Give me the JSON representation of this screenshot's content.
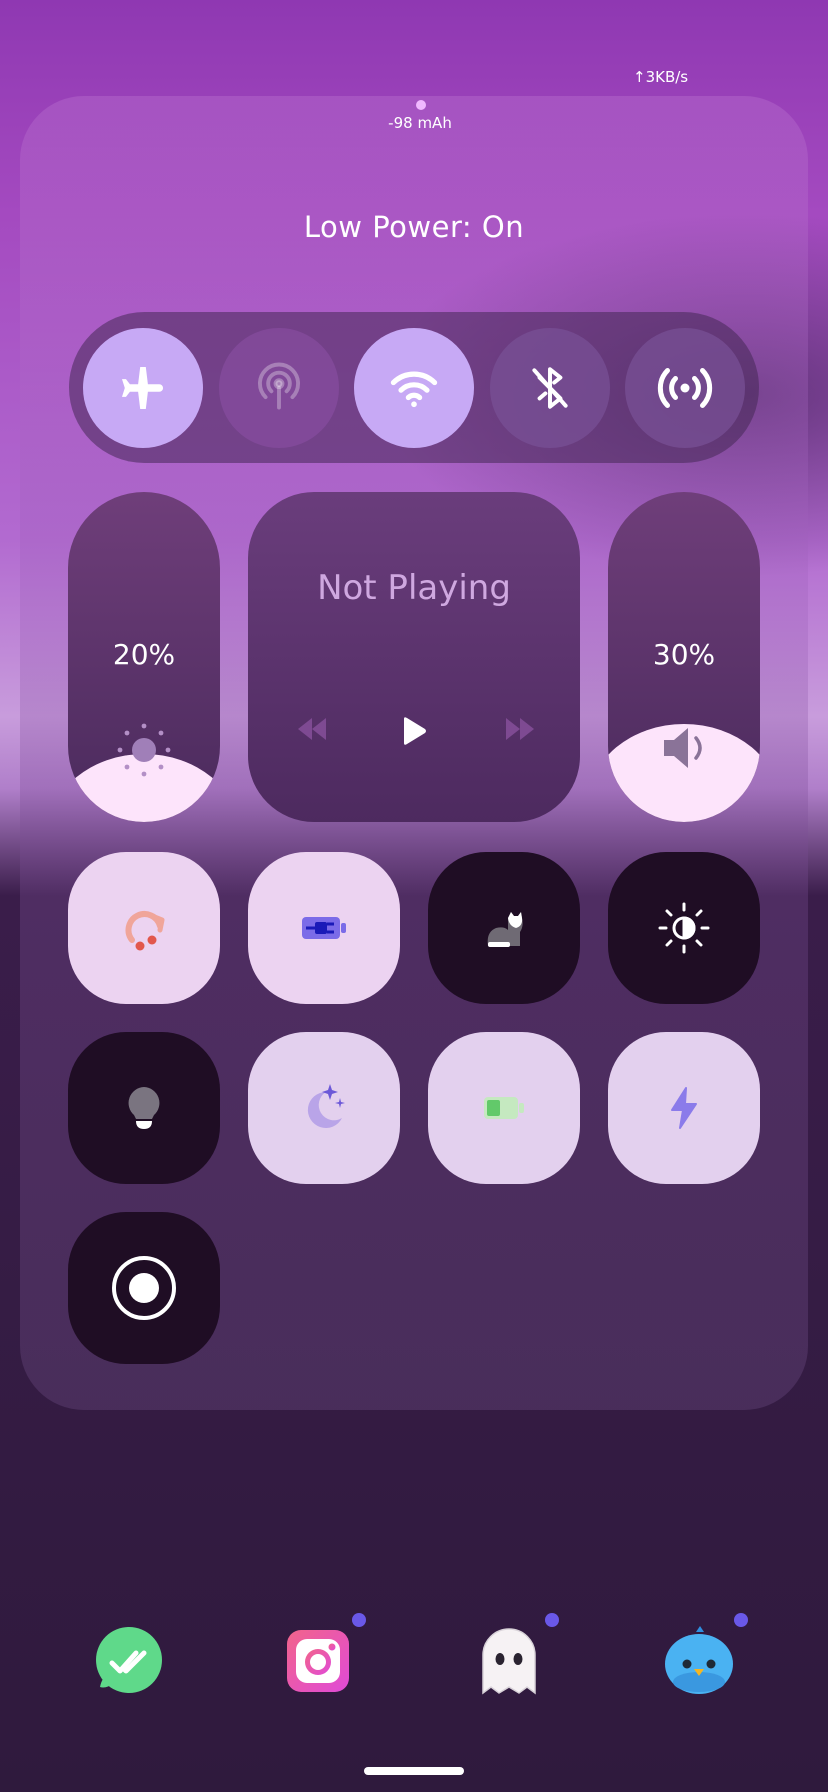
{
  "status": {
    "net_speed": "3KB/s",
    "charge": "-98 mAh"
  },
  "panel": {
    "mode_text": "Low Power: On"
  },
  "connectivity": [
    {
      "name": "airplane-mode",
      "icon": "airplane-icon",
      "state": "on"
    },
    {
      "name": "hotspot",
      "icon": "hotspot-icon",
      "state": "disabled"
    },
    {
      "name": "wifi",
      "icon": "wifi-icon",
      "state": "on"
    },
    {
      "name": "bluetooth",
      "icon": "bluetooth-off-icon",
      "state": "off"
    },
    {
      "name": "nfc",
      "icon": "broadcast-icon",
      "state": "off"
    }
  ],
  "brightness": {
    "label": "20%",
    "level": 0.2
  },
  "volume": {
    "label": "30%",
    "level": 0.3
  },
  "media": {
    "status": "Not Playing"
  },
  "tiles": [
    {
      "name": "rotation-lock",
      "icon": "rotate-icon",
      "state": "on"
    },
    {
      "name": "battery-saver",
      "icon": "battery-plug-icon",
      "state": "on"
    },
    {
      "name": "cat-mode",
      "icon": "cat-icon",
      "state": "off"
    },
    {
      "name": "auto-brightness",
      "icon": "brightness-icon",
      "state": "off"
    },
    {
      "name": "flashlight",
      "icon": "lightbulb-icon",
      "state": "off"
    },
    {
      "name": "night-mode",
      "icon": "moon-icon",
      "state": "on"
    },
    {
      "name": "battery",
      "icon": "battery-icon",
      "state": "on"
    },
    {
      "name": "power-boost",
      "icon": "lightning-icon",
      "state": "on"
    },
    {
      "name": "screen-record",
      "icon": "record-icon",
      "state": "off"
    }
  ],
  "dock": [
    {
      "name": "messages",
      "icon": "chat-icon"
    },
    {
      "name": "camera",
      "icon": "camera-icon"
    },
    {
      "name": "ghost",
      "icon": "ghost-icon"
    },
    {
      "name": "bird",
      "icon": "bird-icon"
    }
  ],
  "colors": {
    "accent": "#c7a9f5",
    "tile_light": "#ecd3f1",
    "tile_dark": "#1f0d24",
    "badge": "#6a58e8"
  }
}
